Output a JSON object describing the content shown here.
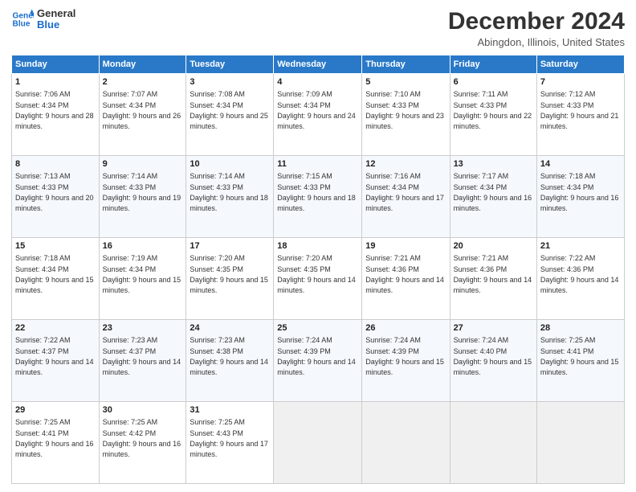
{
  "header": {
    "logo_line1": "General",
    "logo_line2": "Blue",
    "title": "December 2024",
    "subtitle": "Abingdon, Illinois, United States"
  },
  "days_of_week": [
    "Sunday",
    "Monday",
    "Tuesday",
    "Wednesday",
    "Thursday",
    "Friday",
    "Saturday"
  ],
  "weeks": [
    [
      {
        "day": "1",
        "sunrise": "7:06 AM",
        "sunset": "4:34 PM",
        "daylight": "9 hours and 28 minutes."
      },
      {
        "day": "2",
        "sunrise": "7:07 AM",
        "sunset": "4:34 PM",
        "daylight": "9 hours and 26 minutes."
      },
      {
        "day": "3",
        "sunrise": "7:08 AM",
        "sunset": "4:34 PM",
        "daylight": "9 hours and 25 minutes."
      },
      {
        "day": "4",
        "sunrise": "7:09 AM",
        "sunset": "4:34 PM",
        "daylight": "9 hours and 24 minutes."
      },
      {
        "day": "5",
        "sunrise": "7:10 AM",
        "sunset": "4:33 PM",
        "daylight": "9 hours and 23 minutes."
      },
      {
        "day": "6",
        "sunrise": "7:11 AM",
        "sunset": "4:33 PM",
        "daylight": "9 hours and 22 minutes."
      },
      {
        "day": "7",
        "sunrise": "7:12 AM",
        "sunset": "4:33 PM",
        "daylight": "9 hours and 21 minutes."
      }
    ],
    [
      {
        "day": "8",
        "sunrise": "7:13 AM",
        "sunset": "4:33 PM",
        "daylight": "9 hours and 20 minutes."
      },
      {
        "day": "9",
        "sunrise": "7:14 AM",
        "sunset": "4:33 PM",
        "daylight": "9 hours and 19 minutes."
      },
      {
        "day": "10",
        "sunrise": "7:14 AM",
        "sunset": "4:33 PM",
        "daylight": "9 hours and 18 minutes."
      },
      {
        "day": "11",
        "sunrise": "7:15 AM",
        "sunset": "4:33 PM",
        "daylight": "9 hours and 18 minutes."
      },
      {
        "day": "12",
        "sunrise": "7:16 AM",
        "sunset": "4:34 PM",
        "daylight": "9 hours and 17 minutes."
      },
      {
        "day": "13",
        "sunrise": "7:17 AM",
        "sunset": "4:34 PM",
        "daylight": "9 hours and 16 minutes."
      },
      {
        "day": "14",
        "sunrise": "7:18 AM",
        "sunset": "4:34 PM",
        "daylight": "9 hours and 16 minutes."
      }
    ],
    [
      {
        "day": "15",
        "sunrise": "7:18 AM",
        "sunset": "4:34 PM",
        "daylight": "9 hours and 15 minutes."
      },
      {
        "day": "16",
        "sunrise": "7:19 AM",
        "sunset": "4:34 PM",
        "daylight": "9 hours and 15 minutes."
      },
      {
        "day": "17",
        "sunrise": "7:20 AM",
        "sunset": "4:35 PM",
        "daylight": "9 hours and 15 minutes."
      },
      {
        "day": "18",
        "sunrise": "7:20 AM",
        "sunset": "4:35 PM",
        "daylight": "9 hours and 14 minutes."
      },
      {
        "day": "19",
        "sunrise": "7:21 AM",
        "sunset": "4:36 PM",
        "daylight": "9 hours and 14 minutes."
      },
      {
        "day": "20",
        "sunrise": "7:21 AM",
        "sunset": "4:36 PM",
        "daylight": "9 hours and 14 minutes."
      },
      {
        "day": "21",
        "sunrise": "7:22 AM",
        "sunset": "4:36 PM",
        "daylight": "9 hours and 14 minutes."
      }
    ],
    [
      {
        "day": "22",
        "sunrise": "7:22 AM",
        "sunset": "4:37 PM",
        "daylight": "9 hours and 14 minutes."
      },
      {
        "day": "23",
        "sunrise": "7:23 AM",
        "sunset": "4:37 PM",
        "daylight": "9 hours and 14 minutes."
      },
      {
        "day": "24",
        "sunrise": "7:23 AM",
        "sunset": "4:38 PM",
        "daylight": "9 hours and 14 minutes."
      },
      {
        "day": "25",
        "sunrise": "7:24 AM",
        "sunset": "4:39 PM",
        "daylight": "9 hours and 14 minutes."
      },
      {
        "day": "26",
        "sunrise": "7:24 AM",
        "sunset": "4:39 PM",
        "daylight": "9 hours and 15 minutes."
      },
      {
        "day": "27",
        "sunrise": "7:24 AM",
        "sunset": "4:40 PM",
        "daylight": "9 hours and 15 minutes."
      },
      {
        "day": "28",
        "sunrise": "7:25 AM",
        "sunset": "4:41 PM",
        "daylight": "9 hours and 15 minutes."
      }
    ],
    [
      {
        "day": "29",
        "sunrise": "7:25 AM",
        "sunset": "4:41 PM",
        "daylight": "9 hours and 16 minutes."
      },
      {
        "day": "30",
        "sunrise": "7:25 AM",
        "sunset": "4:42 PM",
        "daylight": "9 hours and 16 minutes."
      },
      {
        "day": "31",
        "sunrise": "7:25 AM",
        "sunset": "4:43 PM",
        "daylight": "9 hours and 17 minutes."
      },
      null,
      null,
      null,
      null
    ]
  ],
  "labels": {
    "sunrise": "Sunrise:",
    "sunset": "Sunset:",
    "daylight": "Daylight:"
  }
}
